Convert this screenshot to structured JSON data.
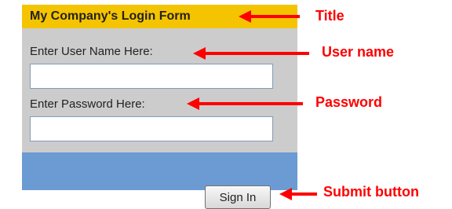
{
  "form": {
    "title": "My Company's Login Form",
    "username_label": "Enter User Name Here:",
    "username_value": "",
    "password_label": "Enter Password Here:",
    "password_value": "",
    "submit_label": "Sign In"
  },
  "annotations": {
    "title": "Title",
    "username": "User name",
    "password": "Password",
    "submit": "Submit button"
  },
  "colors": {
    "header": "#f5c400",
    "body": "#cccccc",
    "footer": "#6b9bd2",
    "annotation": "#ff0000"
  }
}
